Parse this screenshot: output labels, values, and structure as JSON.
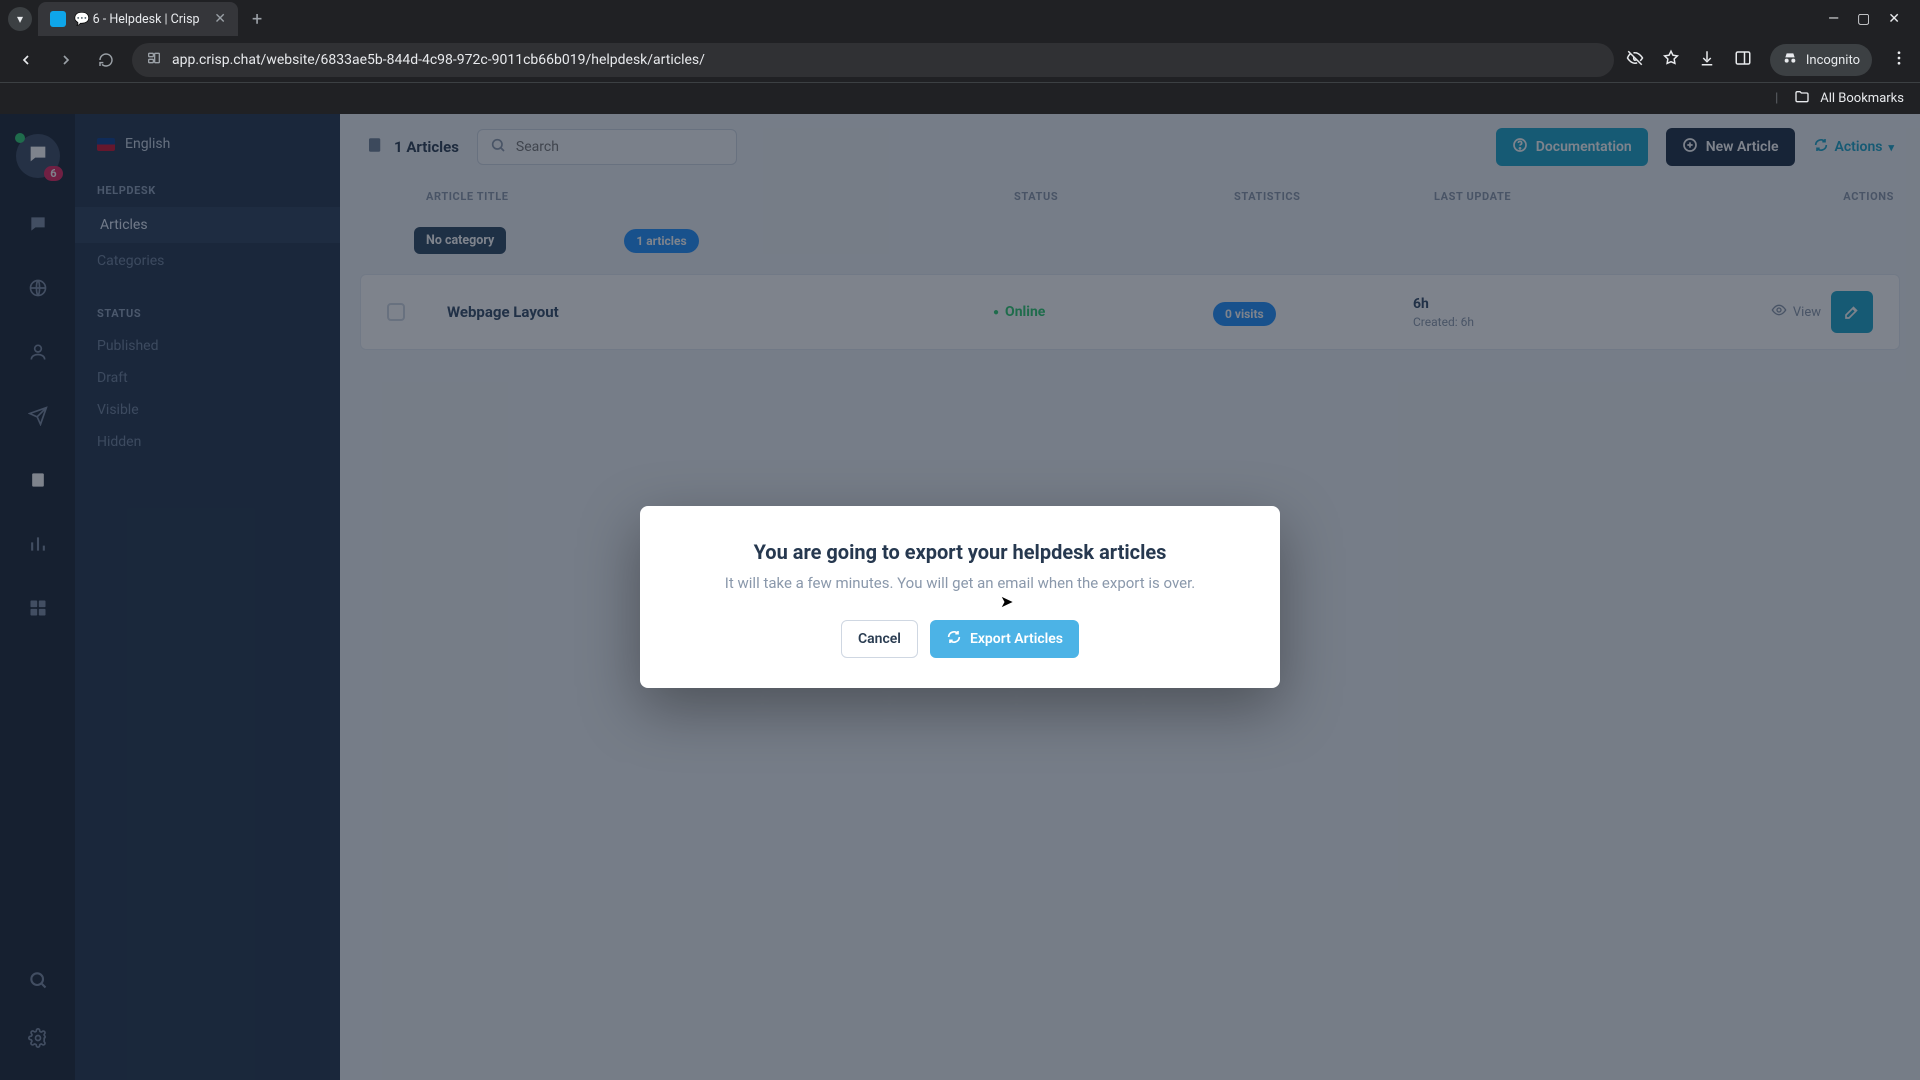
{
  "browser": {
    "tab_title": "💬 6 - Helpdesk | Crisp",
    "url": "app.crisp.chat/website/6833ae5b-844d-4c98-972c-9011cb66b019/helpdesk/articles/",
    "incognito_label": "Incognito",
    "all_bookmarks": "All Bookmarks"
  },
  "rail": {
    "badge": "6"
  },
  "sidebar": {
    "language": "English",
    "sections": {
      "helpdesk_title": "HELPDESK",
      "status_title": "STATUS"
    },
    "items": {
      "articles": "Articles",
      "categories": "Categories",
      "published": "Published",
      "draft": "Draft",
      "visible": "Visible",
      "hidden": "Hidden"
    }
  },
  "topbar": {
    "count": "1 Articles",
    "search_placeholder": "Search",
    "documentation": "Documentation",
    "new_article": "New Article",
    "actions": "Actions"
  },
  "thead": {
    "title": "ARTICLE TITLE",
    "status": "STATUS",
    "stats": "STATISTICS",
    "last": "LAST UPDATE",
    "actions": "ACTIONS"
  },
  "catrow": {
    "no_category": "No category",
    "count": "1 articles"
  },
  "row": {
    "title": "Webpage Layout",
    "status": "Online",
    "visits": "0 visits",
    "updated": "6h",
    "created": "Created: 6h",
    "view": "View"
  },
  "modal": {
    "title": "You are going to export your helpdesk articles",
    "body": "It will take a few minutes. You will get an email when the export is over.",
    "cancel": "Cancel",
    "export": "Export Articles"
  }
}
